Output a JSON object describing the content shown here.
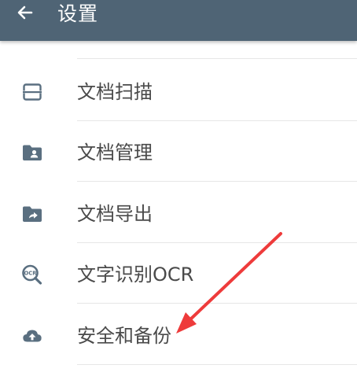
{
  "app": {
    "title": "设置",
    "colors": {
      "toolbar": "#4f6475",
      "icon": "#5a6f80",
      "text": "#4a4a4a",
      "divider": "#e6e6e6",
      "annotation_arrow": "#ee3b3b"
    }
  },
  "toolbar": {
    "back_icon": "arrow-left-icon"
  },
  "menu": {
    "items": [
      {
        "label": "文档扫描",
        "icon": "scan-icon"
      },
      {
        "label": "文档管理",
        "icon": "folder-user-icon"
      },
      {
        "label": "文档导出",
        "icon": "folder-export-icon"
      },
      {
        "label": "文字识别OCR",
        "icon": "ocr-icon"
      },
      {
        "label": "安全和备份",
        "icon": "cloud-upload-icon"
      }
    ]
  }
}
